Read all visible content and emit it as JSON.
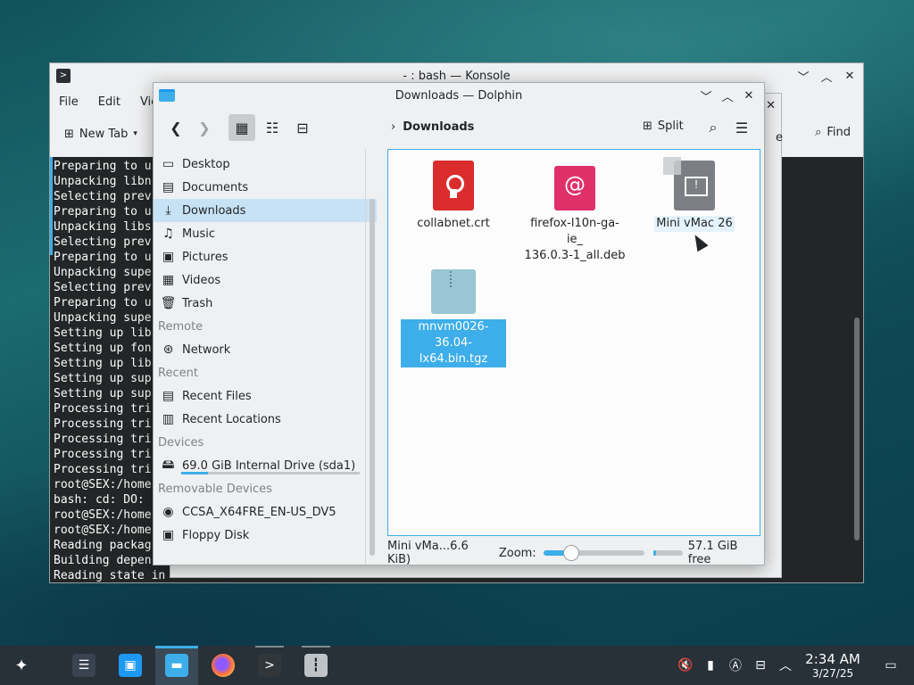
{
  "konsole": {
    "title": "- : bash — Konsole",
    "menu": [
      "File",
      "Edit",
      "Vie"
    ],
    "new_tab": "New Tab",
    "find": "Find",
    "terminal_lines": [
      "Preparing to u",
      "Unpacking libn",
      "Selecting prev",
      "Preparing to u",
      "Unpacking libs",
      "Selecting prev",
      "Preparing to u",
      "Unpacking supe",
      "Selecting prev",
      "Preparing to u",
      "Unpacking supe",
      "Setting up lib",
      "Setting up fon",
      "Setting up lib",
      "Setting up sup",
      "Setting up sup",
      "Processing tri",
      "Processing tri",
      "Processing tri",
      "Processing tri",
      "Processing tri",
      "root@SEX:/home",
      "bash: cd: DO:",
      "root@SEX:/home",
      "root@SEX:/home",
      "Reading packag",
      "Building depen",
      "Reading state in"
    ],
    "ellipsis": "..."
  },
  "ghost": {
    "close": "✕",
    "edge_text": "e"
  },
  "dolphin": {
    "title": "Downloads — Dolphin",
    "breadcrumb": "Downloads",
    "split_label": "Split",
    "places": {
      "main": [
        {
          "label": "Desktop",
          "icon": "desktop-icon",
          "glyph": "▭"
        },
        {
          "label": "Documents",
          "icon": "documents-icon",
          "glyph": "▤"
        },
        {
          "label": "Downloads",
          "icon": "downloads-icon",
          "glyph": "⤓"
        },
        {
          "label": "Music",
          "icon": "music-icon",
          "glyph": "♫"
        },
        {
          "label": "Pictures",
          "icon": "pictures-icon",
          "glyph": "▣"
        },
        {
          "label": "Videos",
          "icon": "videos-icon",
          "glyph": "▦"
        },
        {
          "label": "Trash",
          "icon": "trash-icon",
          "glyph": "🗑"
        }
      ],
      "remote_header": "Remote",
      "remote": [
        {
          "label": "Network",
          "icon": "network-icon",
          "glyph": "⊛"
        }
      ],
      "recent_header": "Recent",
      "recent": [
        {
          "label": "Recent Files",
          "icon": "recent-files-icon",
          "glyph": "▤"
        },
        {
          "label": "Recent Locations",
          "icon": "recent-locations-icon",
          "glyph": "▥"
        }
      ],
      "devices_header": "Devices",
      "drive": {
        "label": "69.0 GiB Internal Drive (sda1)",
        "usage_fraction": 0.15
      },
      "removable_header": "Removable Devices",
      "removable": [
        {
          "label": "CCSA_X64FRE_EN-US_DV5",
          "icon": "optical-disc-icon",
          "glyph": "◉"
        },
        {
          "label": "Floppy Disk",
          "icon": "floppy-disk-icon",
          "glyph": "▣"
        }
      ]
    },
    "files": [
      {
        "name": "collabnet.crt",
        "type": "certificate"
      },
      {
        "name": "firefox-l10n-ga-ie_\n136.0.3-1_all.deb",
        "type": "deb"
      },
      {
        "name": "Mini vMac 26",
        "type": "generic"
      },
      {
        "name": "mnvm0026-36.04-\nlx64.bin.tgz",
        "type": "tgz"
      }
    ],
    "status": {
      "selection": "Mini vMa...6.6 KiB)",
      "zoom_label": "Zoom:",
      "zoom_fraction": 0.28,
      "free_fraction": 0.1,
      "free_text": "57.1 GiB free"
    }
  },
  "taskbar": {
    "clock_time": "2:34 AM",
    "clock_date": "3/27/25"
  },
  "colors": {
    "accent": "#3daee9",
    "selection_bg": "#c8e2f5",
    "terminal_bg": "#232627",
    "taskbar_bg": "#283038"
  }
}
